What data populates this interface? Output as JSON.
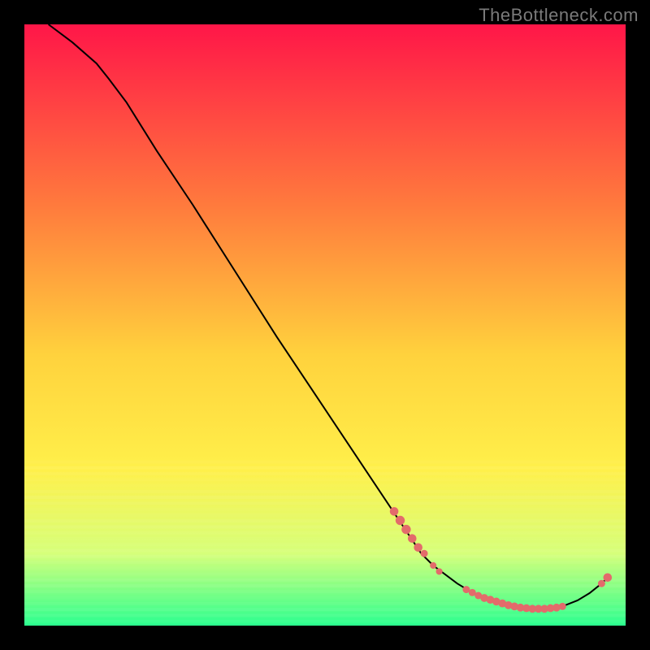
{
  "watermark": "TheBottleneck.com",
  "chart_data": {
    "type": "line",
    "title": "",
    "xlabel": "",
    "ylabel": "",
    "xlim": [
      0,
      100
    ],
    "ylim": [
      0,
      100
    ],
    "background_gradient": {
      "top": "#ff1648",
      "mid_upper": "#ff7a3d",
      "mid": "#ffd23d",
      "mid_lower": "#fff04a",
      "lower": "#d6ff7a",
      "bottom": "#2bff8f"
    },
    "gradient_band_start_y": 73,
    "curve": [
      {
        "x": 4,
        "y": 100
      },
      {
        "x": 8,
        "y": 97
      },
      {
        "x": 12,
        "y": 93.5
      },
      {
        "x": 14,
        "y": 91
      },
      {
        "x": 17,
        "y": 87
      },
      {
        "x": 22,
        "y": 79
      },
      {
        "x": 28,
        "y": 70
      },
      {
        "x": 35,
        "y": 59
      },
      {
        "x": 42,
        "y": 48
      },
      {
        "x": 50,
        "y": 36
      },
      {
        "x": 58,
        "y": 24
      },
      {
        "x": 62,
        "y": 18
      },
      {
        "x": 64,
        "y": 15
      },
      {
        "x": 66,
        "y": 12
      },
      {
        "x": 68,
        "y": 10
      },
      {
        "x": 70,
        "y": 8.5
      },
      {
        "x": 72,
        "y": 7
      },
      {
        "x": 74,
        "y": 5.8
      },
      {
        "x": 76,
        "y": 4.8
      },
      {
        "x": 78,
        "y": 4
      },
      {
        "x": 80,
        "y": 3.4
      },
      {
        "x": 82,
        "y": 3
      },
      {
        "x": 84,
        "y": 2.8
      },
      {
        "x": 86,
        "y": 2.8
      },
      {
        "x": 88,
        "y": 3
      },
      {
        "x": 90,
        "y": 3.4
      },
      {
        "x": 92,
        "y": 4.2
      },
      {
        "x": 94,
        "y": 5.4
      },
      {
        "x": 96,
        "y": 7
      },
      {
        "x": 97,
        "y": 8
      }
    ],
    "markers": [
      {
        "x": 61.5,
        "y": 19,
        "r": 1.3
      },
      {
        "x": 62.5,
        "y": 17.5,
        "r": 1.4
      },
      {
        "x": 63.5,
        "y": 16,
        "r": 1.4
      },
      {
        "x": 64.5,
        "y": 14.5,
        "r": 1.3
      },
      {
        "x": 65.5,
        "y": 13,
        "r": 1.3
      },
      {
        "x": 66.5,
        "y": 12,
        "r": 1.1
      },
      {
        "x": 68,
        "y": 10,
        "r": 1.0
      },
      {
        "x": 69,
        "y": 9,
        "r": 1.0
      },
      {
        "x": 73.5,
        "y": 6,
        "r": 1.1
      },
      {
        "x": 74.5,
        "y": 5.5,
        "r": 1.1
      },
      {
        "x": 75.5,
        "y": 5,
        "r": 1.1
      },
      {
        "x": 76.5,
        "y": 4.6,
        "r": 1.2
      },
      {
        "x": 77.5,
        "y": 4.3,
        "r": 1.2
      },
      {
        "x": 78.5,
        "y": 4,
        "r": 1.2
      },
      {
        "x": 79.5,
        "y": 3.7,
        "r": 1.2
      },
      {
        "x": 80.5,
        "y": 3.4,
        "r": 1.2
      },
      {
        "x": 81.5,
        "y": 3.2,
        "r": 1.2
      },
      {
        "x": 82.5,
        "y": 3,
        "r": 1.2
      },
      {
        "x": 83.5,
        "y": 2.9,
        "r": 1.2
      },
      {
        "x": 84.5,
        "y": 2.8,
        "r": 1.2
      },
      {
        "x": 85.5,
        "y": 2.8,
        "r": 1.2
      },
      {
        "x": 86.5,
        "y": 2.8,
        "r": 1.2
      },
      {
        "x": 87.5,
        "y": 2.9,
        "r": 1.2
      },
      {
        "x": 88.5,
        "y": 3,
        "r": 1.2
      },
      {
        "x": 89.5,
        "y": 3.2,
        "r": 1.1
      },
      {
        "x": 96,
        "y": 7,
        "r": 1.1
      },
      {
        "x": 97,
        "y": 8,
        "r": 1.3
      }
    ],
    "marker_color": "#e36b6b",
    "curve_color": "#000000"
  }
}
